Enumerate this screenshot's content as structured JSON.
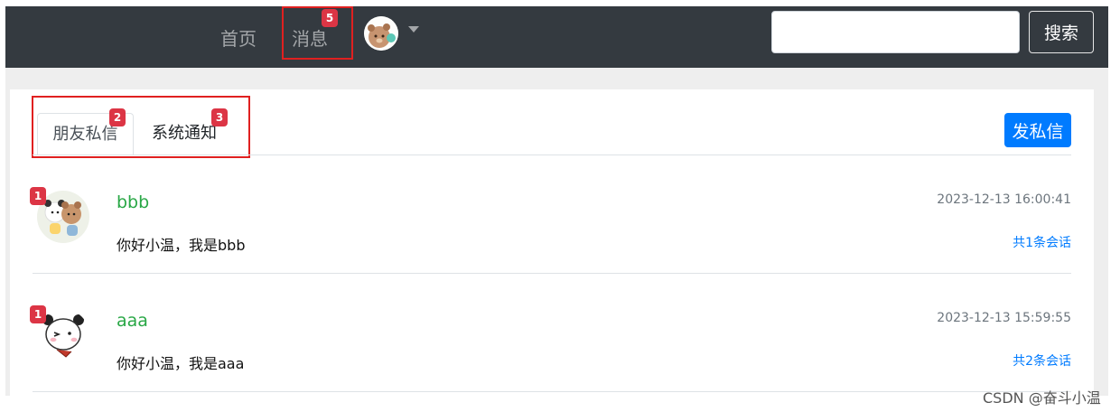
{
  "nav": {
    "home_label": "首页",
    "messages_label": "消息",
    "messages_badge": "5",
    "search_placeholder": "",
    "search_button": "搜索"
  },
  "tabs": {
    "items": [
      {
        "label": "朋友私信",
        "badge": "2",
        "active": true
      },
      {
        "label": "系统通知",
        "badge": "3",
        "active": false
      }
    ],
    "send_button": "发私信"
  },
  "conversations": [
    {
      "name": "bbb",
      "message": "你好小温，我是bbb",
      "time": "2023-12-13 16:00:41",
      "count": "共1条会话",
      "badge": "1"
    },
    {
      "name": "aaa",
      "message": "你好小温，我是aaa",
      "time": "2023-12-13 15:59:55",
      "count": "共2条会话",
      "badge": "1"
    }
  ],
  "watermark": "CSDN @奋斗小温",
  "colors": {
    "navbar": "#343a40",
    "badge": "#dc3545",
    "primary": "#007bff",
    "name_green": "#28a745"
  }
}
